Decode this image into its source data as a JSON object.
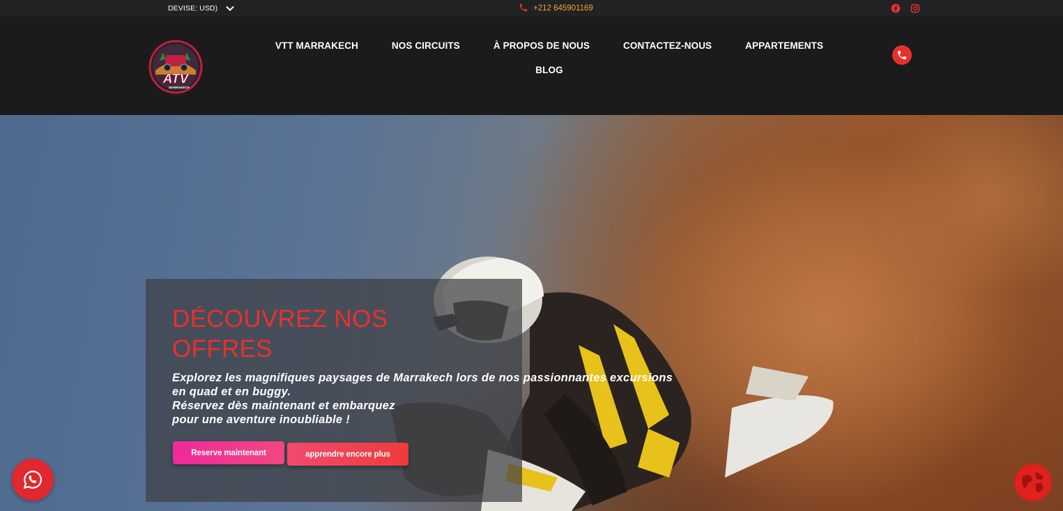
{
  "topbar": {
    "currency_label": "DEVISE: USD)",
    "phone": "+212 645901169"
  },
  "nav": {
    "items": [
      "VTT MARRAKECH",
      "NOS CIRCUITS",
      "À PROPOS DE NOUS",
      "CONTACTEZ-NOUS",
      "APPARTEMENTS",
      "BLOG"
    ]
  },
  "logo": {
    "text": "ATV",
    "subtext": "MARRAKECH"
  },
  "hero": {
    "title_line1": "DÉCOUVREZ NOS",
    "title_line2": "OFFRES",
    "text_lines": [
      "Explorez les magnifiques paysages de Marrakech lors de nos passionnantes excursions",
      "en quad et en buggy.",
      "Réservez dès maintenant et embarquez",
      "pour une aventure inoubliable !"
    ],
    "book_label": "Reserve maintenant",
    "more_label": "apprendre encore plus"
  },
  "colors": {
    "accent_red": "#e8312c",
    "phone_orange": "#f5a623",
    "header_bg": "#1b1b1c",
    "book_gradient": "#ee2a9c",
    "more_gradient": "#f04a6e"
  },
  "icons": {
    "currency": "chevron-down-icon",
    "phone": "phone-icon",
    "facebook": "facebook-icon",
    "instagram": "instagram-icon",
    "call": "phone-icon",
    "whatsapp": "whatsapp-icon",
    "globe": "globe-icon"
  }
}
